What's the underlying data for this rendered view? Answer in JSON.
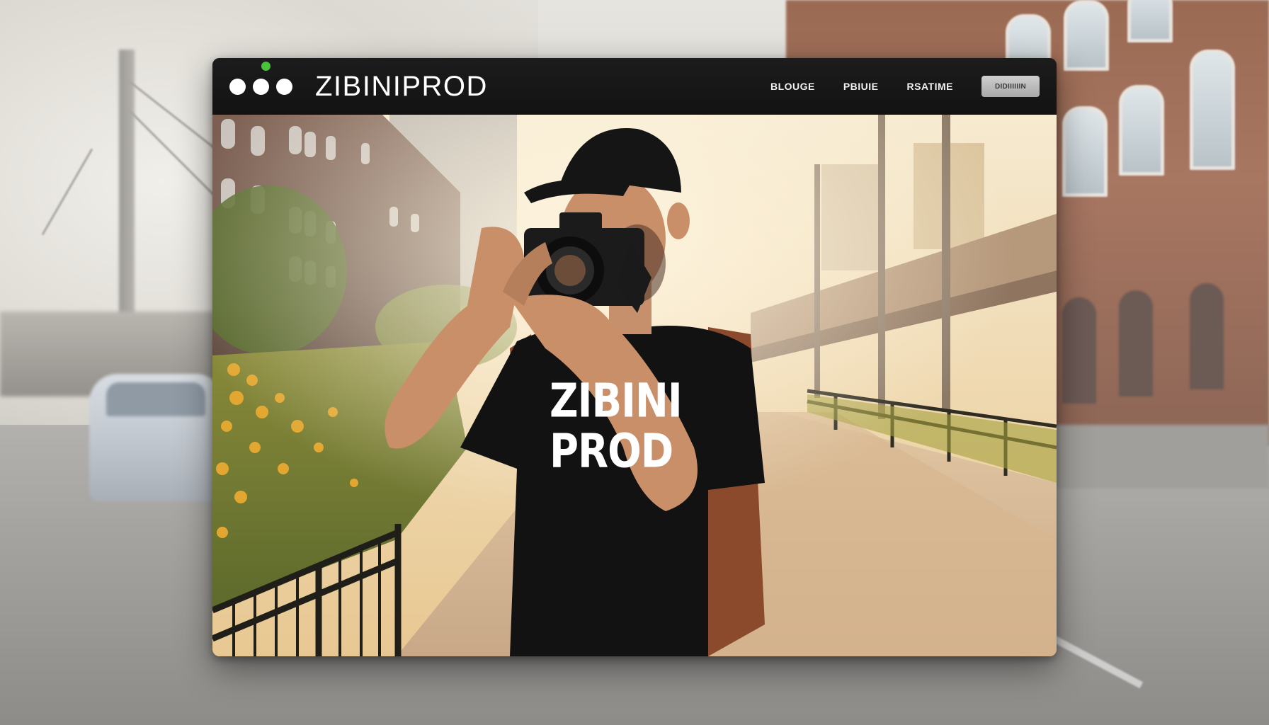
{
  "window": {
    "brand": "ZIBINIPROD",
    "nav": {
      "links": [
        "BLOUGE",
        "PBIUIE",
        "RSATIME"
      ],
      "button_label": "DIDIIIIIIN"
    },
    "colors": {
      "titlebar": "#121212",
      "accent_dot": "#47c43b",
      "text": "#ffffff",
      "button": "#bdbdbd"
    }
  },
  "hero": {
    "shirt_text_line1": "ZIBINI",
    "shirt_text_line2": "PROD"
  }
}
